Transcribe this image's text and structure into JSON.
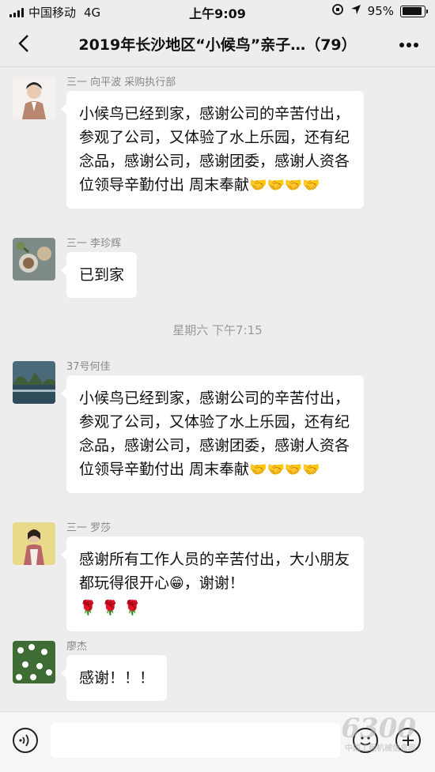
{
  "status_bar": {
    "carrier": "中国移动",
    "network": "4G",
    "time": "上午9:09",
    "battery": "95%"
  },
  "nav": {
    "title": "2019年长沙地区“小候鸟”亲子…（79）"
  },
  "messages": [
    {
      "sender": "三一 向平波 采购执行部",
      "text": "小候鸟已经到家，感谢公司的辛苦付出，参观了公司，又体验了水上乐园，还有纪念品，感谢公司，感谢团委，感谢人资各位领导辛勤付出 周末奉献",
      "emoji": "🤝🤝🤝🤝"
    },
    {
      "sender": "三一 李珍辉",
      "text": "已到家"
    },
    {
      "sender": "37号何佳",
      "text": "小候鸟已经到家，感谢公司的辛苦付出，参观了公司，又体验了水上乐园，还有纪念品，感谢公司，感谢团委，感谢人资各位领导辛勤付出 周末奉献",
      "emoji": "🤝🤝🤝🤝"
    },
    {
      "sender": "三一 罗莎",
      "text": "感谢所有工作人员的辛苦付出，大小朋友都玩得很开心",
      "emoji": "😁",
      "text2": "，谢谢！",
      "emoji2": "🌹 🌹 🌹"
    },
    {
      "sender": "廖杰",
      "text": "感谢！！！"
    }
  ],
  "time_separator": "星期六 下午7:15",
  "watermark": {
    "number": "6300",
    "caption": "中国工程机械信息网"
  }
}
